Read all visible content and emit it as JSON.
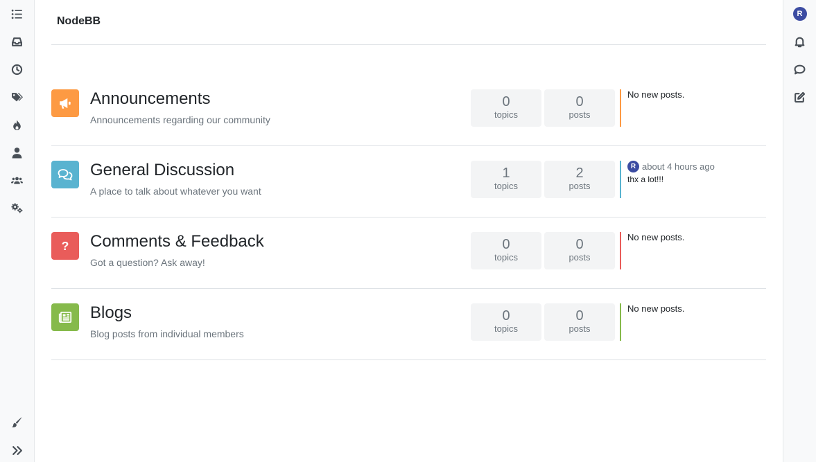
{
  "brand": {
    "name": "NodeBB"
  },
  "user": {
    "avatar_letter": "R",
    "avatar_color": "#3c4ca2"
  },
  "left_nav": [
    {
      "name": "categories",
      "icon": "list-icon"
    },
    {
      "name": "unread",
      "icon": "inbox-icon"
    },
    {
      "name": "recent",
      "icon": "clock-icon"
    },
    {
      "name": "tags",
      "icon": "tags-icon"
    },
    {
      "name": "popular",
      "icon": "fire-icon"
    },
    {
      "name": "users",
      "icon": "user-icon"
    },
    {
      "name": "groups",
      "icon": "users-icon"
    },
    {
      "name": "admin",
      "icon": "gears-icon"
    },
    {
      "name": "skins",
      "icon": "brush-icon"
    },
    {
      "name": "expand",
      "icon": "chevrons-right-icon"
    }
  ],
  "right_nav": [
    {
      "name": "user-menu",
      "icon": "avatar"
    },
    {
      "name": "notifications",
      "icon": "bell-icon"
    },
    {
      "name": "chats",
      "icon": "chat-icon"
    },
    {
      "name": "new-topic",
      "icon": "compose-icon"
    }
  ],
  "categories": [
    {
      "title": "Announcements",
      "description": "Announcements regarding our community",
      "icon": "bullhorn-icon",
      "color": "#fd9a43",
      "topics": "0",
      "topics_label": "topics",
      "posts": "0",
      "posts_label": "posts",
      "teaser": {
        "empty": true,
        "text": "No new posts."
      }
    },
    {
      "title": "General Discussion",
      "description": "A place to talk about whatever you want",
      "icon": "comments-icon",
      "color": "#59b3d0",
      "topics": "1",
      "topics_label": "topics",
      "posts": "2",
      "posts_label": "posts",
      "teaser": {
        "empty": false,
        "avatar_letter": "R",
        "time": "about 4 hours ago",
        "text": "thx a lot!!!"
      }
    },
    {
      "title": "Comments & Feedback",
      "description": "Got a question? Ask away!",
      "icon": "question-icon",
      "color": "#e95c5a",
      "topics": "0",
      "topics_label": "topics",
      "posts": "0",
      "posts_label": "posts",
      "teaser": {
        "empty": true,
        "text": "No new posts."
      }
    },
    {
      "title": "Blogs",
      "description": "Blog posts from individual members",
      "icon": "newspaper-icon",
      "color": "#86ba4b",
      "topics": "0",
      "topics_label": "topics",
      "posts": "0",
      "posts_label": "posts",
      "teaser": {
        "empty": true,
        "text": "No new posts."
      }
    }
  ]
}
